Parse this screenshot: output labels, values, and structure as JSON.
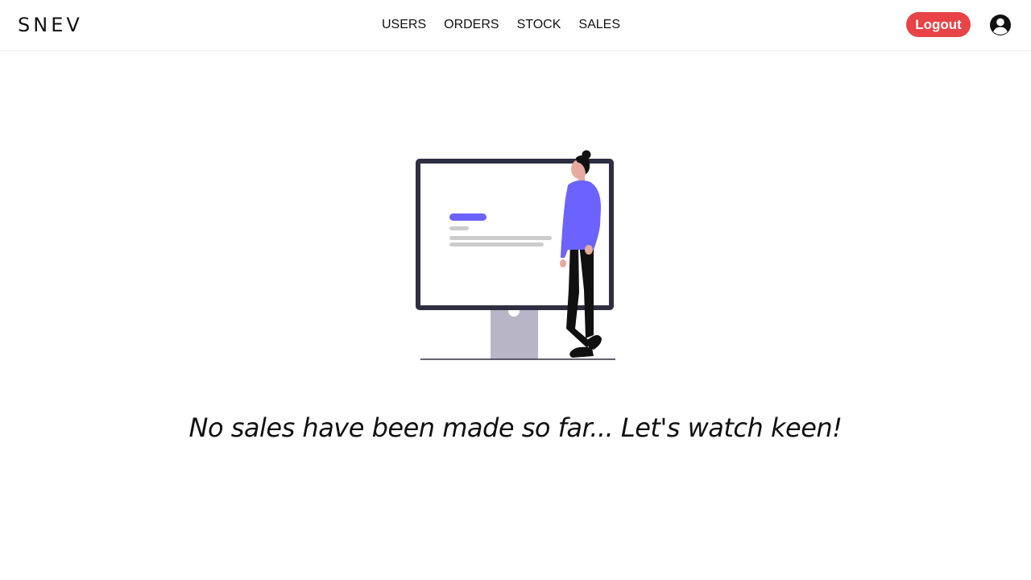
{
  "header": {
    "brand": "SNEV",
    "nav": [
      {
        "label": "USERS"
      },
      {
        "label": "ORDERS"
      },
      {
        "label": "STOCK"
      },
      {
        "label": "SALES"
      }
    ],
    "logout_label": "Logout",
    "account_icon": "user-circle-icon"
  },
  "main": {
    "illustration_icon": "person-with-monitor-illustration",
    "empty_message": "No sales have been made so far... Let's watch keen!"
  },
  "colors": {
    "logout_bg": "#e84346",
    "accent": "#6c63ff",
    "text": "#111111"
  }
}
